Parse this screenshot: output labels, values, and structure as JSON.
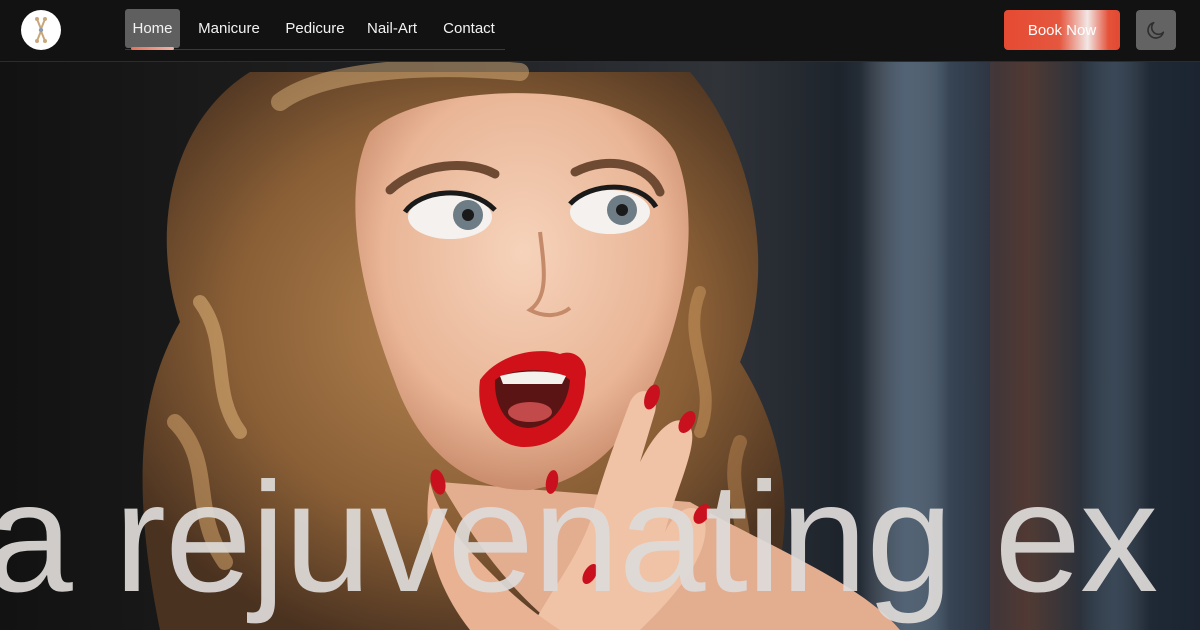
{
  "header": {
    "logo_icon": "nail-salon-logo-icon",
    "nav": [
      {
        "label": "Home",
        "active": true
      },
      {
        "label": "Manicure",
        "active": false
      },
      {
        "label": "Pedicure",
        "active": false
      },
      {
        "label": "Nail-Art",
        "active": false
      },
      {
        "label": "Contact",
        "active": false
      }
    ],
    "book_button": "Book Now",
    "theme_toggle_icon": "moon-icon"
  },
  "hero": {
    "text": "a rejuvenating ex",
    "image": "woman-surprised-red-lips-red-nails"
  },
  "colors": {
    "accent": "#e64a32",
    "header_bg": "#121212",
    "active_tab_bg": "#5f5f5f",
    "hero_text": "#dedad8"
  }
}
